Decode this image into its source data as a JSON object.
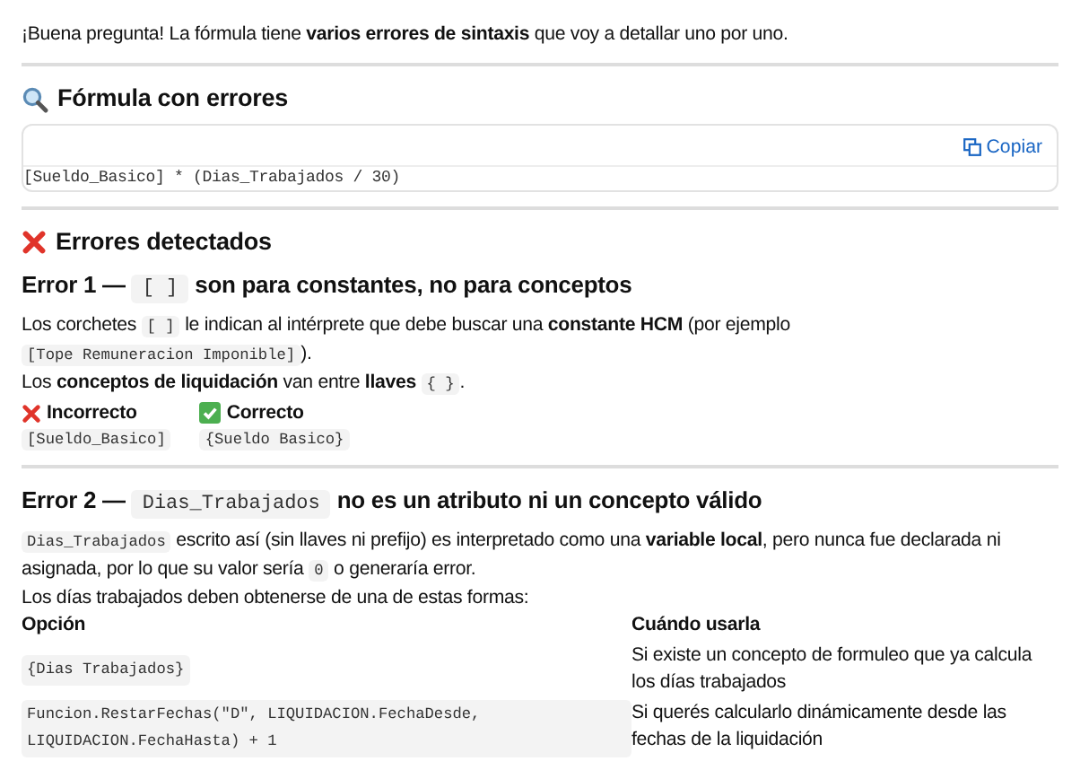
{
  "intro": "¡Buena pregunta! La fórmula tiene **varios errores de sintaxis** que voy a detallar uno por uno.",
  "formula_section": {
    "title": "Fórmula con errores",
    "copy_label": "Copiar",
    "code": "[Sueldo_Basico] * (Dias_Trabajados / 30)"
  },
  "errors_section": {
    "title": "Errores detectados",
    "errors": [
      {
        "heading": [
          {
            "kind": "text",
            "text": "Error 1 — "
          },
          {
            "kind": "code",
            "text": "[ ]"
          },
          {
            "kind": "text",
            "text": " son para constantes, no para conceptos"
          }
        ],
        "paragraphs": [
          [
            {
              "kind": "text",
              "text": "Los corchetes "
            },
            {
              "kind": "code",
              "text": "[ ]"
            },
            {
              "kind": "text",
              "text": " le indican al intérprete que debe buscar una **constante HCM** (por ejemplo "
            },
            {
              "kind": "code",
              "text": "[Tope Remuneracion Imponible]"
            },
            {
              "kind": "text",
              "text": ")."
            }
          ],
          [
            {
              "kind": "text",
              "text": "Los **conceptos de liquidación** van entre **llaves** "
            },
            {
              "kind": "code",
              "text": "{ }"
            },
            {
              "kind": "text",
              "text": "."
            }
          ]
        ],
        "comparison": [
          {
            "kind": "wrong",
            "label": "Incorrecto",
            "code": "[Sueldo_Basico]"
          },
          {
            "kind": "right",
            "label": "Correcto",
            "code": "{Sueldo Basico}"
          }
        ]
      },
      {
        "heading": [
          {
            "kind": "text",
            "text": "Error 2 — "
          },
          {
            "kind": "code",
            "text": "Dias_Trabajados"
          },
          {
            "kind": "text",
            "text": " no es un atributo ni un concepto válido"
          }
        ],
        "paragraphs": [
          [
            {
              "kind": "code",
              "text": "Dias_Trabajados"
            },
            {
              "kind": "text",
              "text": " escrito así (sin llaves ni prefijo) es interpretado como una **variable local**, pero nunca fue declarada ni asignada, por lo que su valor sería "
            },
            {
              "kind": "code",
              "text": "0"
            },
            {
              "kind": "text",
              "text": " o generaría error."
            }
          ],
          [
            {
              "kind": "text",
              "text": "Los días trabajados deben obtenerse de una de estas formas:"
            }
          ]
        ],
        "table": {
          "columns": [
            "Opción",
            "Cuándo usarla"
          ],
          "rows": [
            {
              "option": "{Dias Trabajados}",
              "when": "Si existe un concepto de formuleo que ya calcula los días trabajados"
            },
            {
              "option": "Funcion.RestarFechas(\"D\", LIQUIDACION.FechaDesde, LIQUIDACION.FechaHasta) + 1",
              "when": "Si querés calcularlo dinámicamente desde las fechas de la liquidación"
            }
          ]
        }
      }
    ]
  }
}
